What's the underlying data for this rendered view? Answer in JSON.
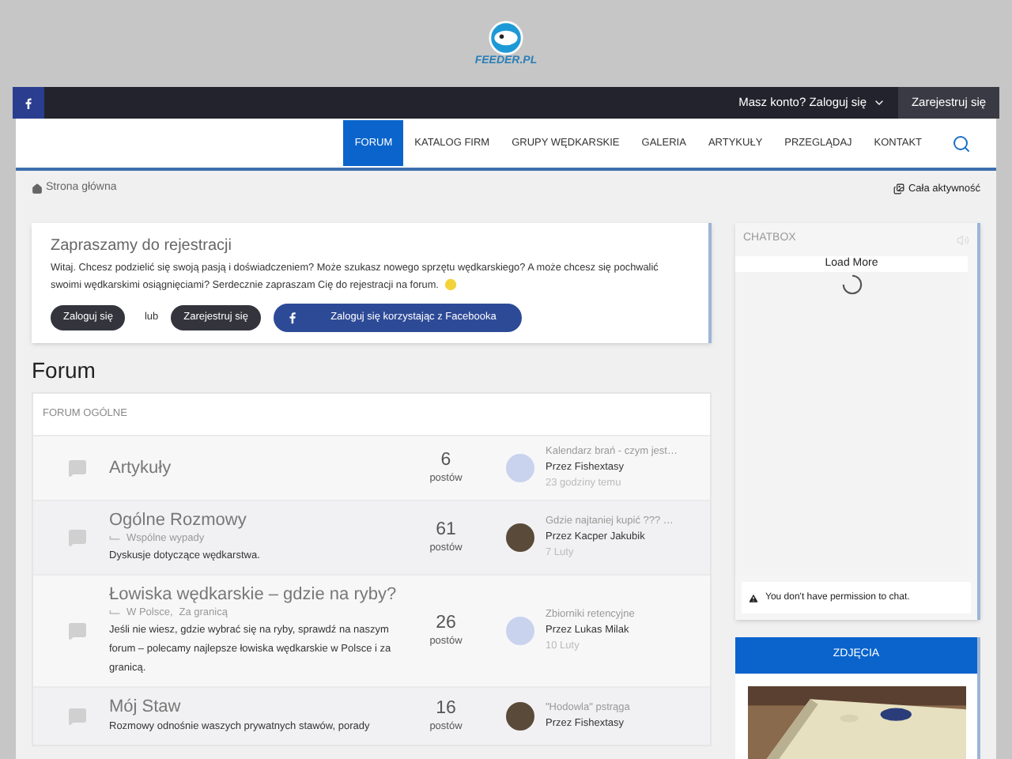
{
  "logo": {
    "text": "FEEDER.PL"
  },
  "topbar": {
    "account": "Masz konto? Zaloguj się",
    "register": "Zarejestruj się"
  },
  "nav": [
    {
      "label": "FORUM",
      "selected": true
    },
    {
      "label": "KATALOG FIRM",
      "selected": false
    },
    {
      "label": "GRUPY WĘDKARSKIE",
      "selected": false
    },
    {
      "label": "GALERIA",
      "selected": false
    },
    {
      "label": "ARTYKUŁY",
      "selected": false
    },
    {
      "label": "PRZEGLĄDAJ",
      "selected": false
    },
    {
      "label": "KONTAKT",
      "selected": false
    }
  ],
  "breadcrumb": "Strona główna",
  "activity": "Cała aktywność",
  "welcome": {
    "title": "Zapraszamy do rejestracji",
    "text": "Witaj. Chcesz podzielić się swoją pasją i doświadczeniem? Może szukasz nowego sprzętu wędkarskiego? A może chcesz się pochwalić swoimi wędkarskimi osiągnięciami? Serdecznie zapraszam Cię do rejestracji na forum.",
    "login": "Zaloguj się",
    "or": "lub",
    "register": "Zarejestruj się",
    "facebook": "Zaloguj się korzystając z Facebooka"
  },
  "forum_title": "Forum",
  "category": "FORUM OGÓLNE",
  "forums": [
    {
      "name": "Artykuły",
      "count": "6",
      "unit": "postów",
      "last_title": "Kalendarz brań - czym jest…",
      "last_by": "Przez Fishextasy",
      "last_time": "23 godziny temu"
    },
    {
      "name": "Ogólne Rozmowy",
      "subforums": [
        "Wspólne wypady"
      ],
      "description": "Dyskusje dotyczące wędkarstwa.",
      "count": "61",
      "unit": "postów",
      "last_title": "Gdzie najtaniej kupić ??? …",
      "last_by": "Przez Kacper Jakubik",
      "last_time": "7 Luty"
    },
    {
      "name": "Łowiska wędkarskie – gdzie na ryby?",
      "subforums": [
        "W Polsce,",
        "Za granicą"
      ],
      "description": "Jeśli nie wiesz, gdzie wybrać się na ryby, sprawdź na naszym forum – polecamy najlepsze łowiska wędkarskie w Polsce i za granicą.",
      "count": "26",
      "unit": "postów",
      "last_title": "Zbiorniki retencyjne",
      "last_by": "Przez Lukas Milak",
      "last_time": "10 Luty"
    },
    {
      "name": "Mój Staw",
      "description": "Rozmowy odnośnie waszych prywatnych stawów, porady",
      "count": "16",
      "unit": "postów",
      "last_title": "\"Hodowla\" pstrąga",
      "last_by": "Przez Fishextasy"
    }
  ],
  "chatbox": {
    "title": "CHATBOX",
    "load_more": "Load More",
    "notice": "You don't have permission to chat."
  },
  "photos": {
    "title": "ZDJĘCIA",
    "kind": "picture"
  }
}
